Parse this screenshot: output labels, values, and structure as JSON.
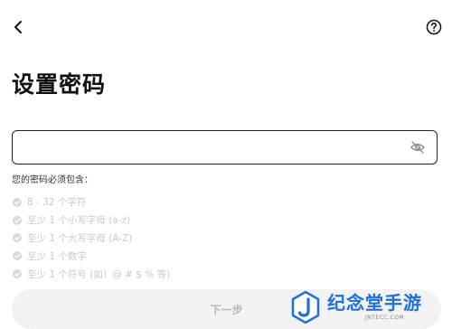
{
  "header": {
    "back_icon": "chevron-left-icon",
    "help_icon": "question-circle-icon"
  },
  "page": {
    "title": "设置密码"
  },
  "password_field": {
    "value": "",
    "placeholder": "",
    "visibility_icon": "eye-off-icon"
  },
  "requirements": {
    "heading": "您的密码必须包含：",
    "items": [
      "8 - 32 个字符",
      "至少 1 个小写字母 (a-z)",
      "至少 1 个大写字母 (A-Z)",
      "至少 1 个数字",
      "至少 1 个符号 (如！@ # $ % 等)"
    ]
  },
  "next_button": {
    "label": "下一步"
  },
  "watermark": {
    "text": "纪念堂手游",
    "subtext": "JNTECC.COM"
  },
  "colors": {
    "text_primary": "#111111",
    "requirement_disabled": "#c9c9c9",
    "button_disabled_bg": "#f2f2f2",
    "button_disabled_text": "#b8b8b8",
    "watermark_blue": "#1e6fd9"
  }
}
